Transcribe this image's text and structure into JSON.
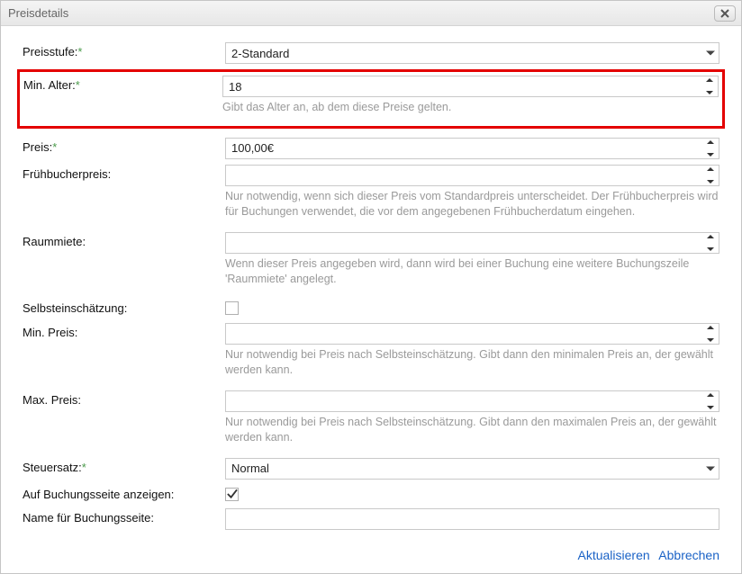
{
  "title": "Preisdetails",
  "fields": {
    "preisstufe": {
      "label": "Preisstufe:",
      "required": true,
      "value": "2-Standard"
    },
    "min_alter": {
      "label": "Min. Alter:",
      "required": true,
      "value": "18",
      "help": "Gibt das Alter an, ab dem diese Preise gelten."
    },
    "preis": {
      "label": "Preis:",
      "required": true,
      "value": "100,00€"
    },
    "fruehbucherpreis": {
      "label": "Frühbucherpreis:",
      "value": "",
      "help": "Nur notwendig, wenn sich dieser Preis vom Standardpreis unterscheidet. Der Frühbucherpreis wird für Buchungen verwendet, die vor dem angegebenen Frühbucherdatum eingehen."
    },
    "raummiete": {
      "label": "Raummiete:",
      "value": "",
      "help": "Wenn dieser Preis angegeben wird, dann wird bei einer Buchung eine weitere Buchungszeile 'Raummiete' angelegt."
    },
    "selbsteinschaetzung": {
      "label": "Selbsteinschätzung:",
      "checked": false
    },
    "min_preis": {
      "label": "Min. Preis:",
      "value": "",
      "help": "Nur notwendig bei Preis nach Selbsteinschätzung. Gibt dann den minimalen Preis an, der gewählt werden kann."
    },
    "max_preis": {
      "label": "Max. Preis:",
      "value": "",
      "help": "Nur notwendig bei Preis nach Selbsteinschätzung. Gibt dann den maximalen Preis an, der gewählt werden kann."
    },
    "steuersatz": {
      "label": "Steuersatz:",
      "required": true,
      "value": "Normal"
    },
    "auf_buchungsseite": {
      "label": "Auf Buchungsseite anzeigen:",
      "checked": true
    },
    "name_buchungsseite": {
      "label": "Name für Buchungsseite:",
      "value": ""
    }
  },
  "actions": {
    "update": "Aktualisieren",
    "cancel": "Abbrechen"
  },
  "required_marker": "*"
}
